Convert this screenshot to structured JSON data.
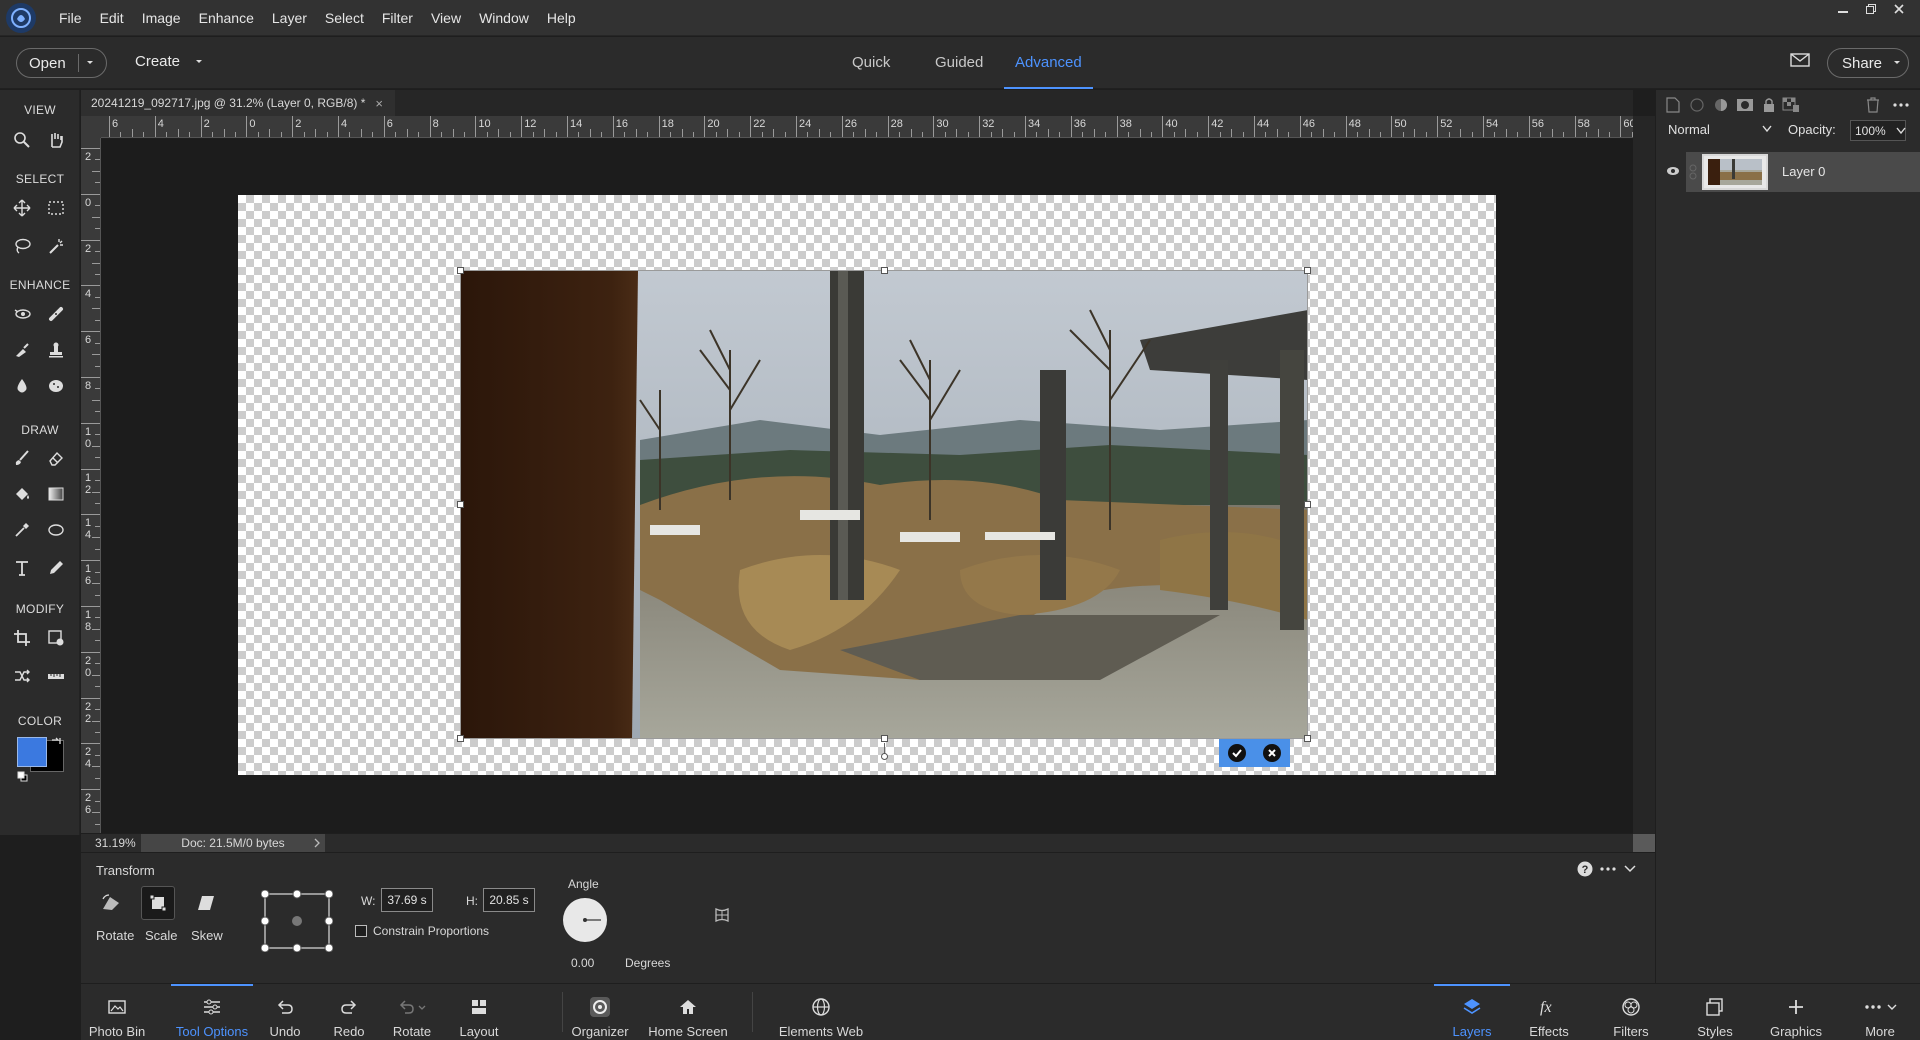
{
  "menubar": {
    "items": [
      "File",
      "Edit",
      "Image",
      "Enhance",
      "Layer",
      "Select",
      "Filter",
      "View",
      "Window",
      "Help"
    ]
  },
  "modebar": {
    "open_label": "Open",
    "create_label": "Create",
    "tabs": [
      {
        "label": "Quick",
        "active": false
      },
      {
        "label": "Guided",
        "active": false
      },
      {
        "label": "Advanced",
        "active": true
      }
    ],
    "share_label": "Share"
  },
  "toolbar": {
    "sections": [
      "VIEW",
      "SELECT",
      "ENHANCE",
      "DRAW",
      "MODIFY",
      "COLOR"
    ],
    "foreground_color": "#3b79e0",
    "background_color": "#000000"
  },
  "document": {
    "tab_title": "20241219_092717.jpg @ 31.2% (Layer 0, RGB/8) *",
    "close_glyph": "×"
  },
  "rulers": {
    "top_labels": [
      "6",
      "4",
      "2",
      "0",
      "2",
      "4",
      "6",
      "8",
      "10",
      "12",
      "14",
      "16",
      "18",
      "20",
      "22",
      "24",
      "26",
      "28",
      "30",
      "32",
      "34",
      "36",
      "38",
      "40",
      "42",
      "44",
      "46",
      "48",
      "50",
      "52",
      "54",
      "56",
      "58",
      "60"
    ],
    "left_labels": [
      "2",
      "0",
      "2",
      "4",
      "6",
      "8",
      "1\n0",
      "1\n2",
      "1\n4",
      "1\n6",
      "1\n8",
      "2\n0",
      "2\n2",
      "2\n4",
      "2\n6"
    ]
  },
  "status": {
    "zoom": "31.19%",
    "doc_info": "Doc: 21.5M/0 bytes"
  },
  "tool_options": {
    "title": "Transform",
    "modes": [
      {
        "label": "Rotate",
        "icon": "rotate-mode-icon",
        "active": false
      },
      {
        "label": "Scale",
        "icon": "scale-mode-icon",
        "active": true
      },
      {
        "label": "Skew",
        "icon": "skew-mode-icon",
        "active": false
      }
    ],
    "w_label": "W:",
    "w_value": "37.69 s",
    "h_label": "H:",
    "h_value": "20.85 s",
    "constrain_label": "Constrain Proportions",
    "constrain_checked": false,
    "angle_label": "Angle",
    "angle_value": "0.00",
    "angle_unit": "Degrees"
  },
  "taskbar": {
    "left": [
      {
        "label": "Photo Bin",
        "icon": "photo-bin-icon",
        "state": "normal"
      },
      {
        "label": "Tool Options",
        "icon": "tool-options-icon",
        "state": "active"
      },
      {
        "label": "Undo",
        "icon": "undo-icon",
        "state": "normal"
      },
      {
        "label": "Redo",
        "icon": "redo-icon",
        "state": "normal"
      },
      {
        "label": "Rotate",
        "icon": "rotate-icon",
        "state": "normal"
      },
      {
        "label": "Layout",
        "icon": "layout-icon",
        "state": "normal"
      },
      {
        "label": "Organizer",
        "icon": "organizer-icon",
        "state": "normal"
      },
      {
        "label": "Home Screen",
        "icon": "home-icon",
        "state": "normal"
      },
      {
        "label": "Elements Web",
        "icon": "globe-icon",
        "state": "normal"
      }
    ],
    "right": [
      {
        "label": "Layers",
        "icon": "layers-icon",
        "state": "active"
      },
      {
        "label": "Effects",
        "icon": "effects-icon",
        "state": "normal"
      },
      {
        "label": "Filters",
        "icon": "filters-icon",
        "state": "normal"
      },
      {
        "label": "Styles",
        "icon": "styles-icon",
        "state": "normal"
      },
      {
        "label": "Graphics",
        "icon": "graphics-icon",
        "state": "normal"
      },
      {
        "label": "More",
        "icon": "more-icon",
        "state": "normal"
      }
    ]
  },
  "layers": {
    "blend_mode": "Normal",
    "opacity_label": "Opacity:",
    "opacity_value": "100%",
    "items": [
      {
        "name": "Layer 0",
        "visible": true
      }
    ]
  },
  "colors": {
    "accent": "#4d93ff",
    "commit_bar": "#4a90e8"
  }
}
